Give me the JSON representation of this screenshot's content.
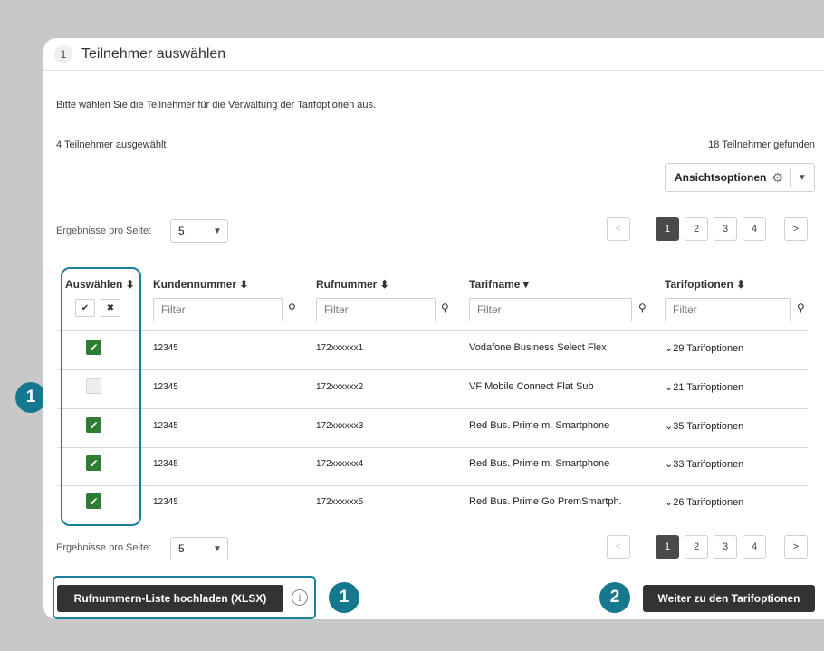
{
  "step": {
    "number": "1",
    "title": "Teilnehmer auswählen"
  },
  "intro_text": "Bitte wählen Sie die Teilnehmer für die Verwaltung der Tarifoptionen aus.",
  "selected_count": "4 Teilnehmer ausgewählt",
  "found_count": "18 Teilnehmer gefunden",
  "view_options_label": "Ansichtsoptionen",
  "per_page": {
    "label": "Ergebnisse pro Seite:",
    "value": "5"
  },
  "pagination": {
    "prev": "<",
    "next": ">",
    "pages": [
      "1",
      "2",
      "3",
      "4"
    ],
    "active": "1"
  },
  "columns": {
    "select": "Auswählen ⬍",
    "customer": "Kundennummer ⬍",
    "phone": "Rufnummer ⬍",
    "tariff": "Tarifname ▾",
    "options": "Tarifoptionen ⬍"
  },
  "filter_placeholder": "Filter",
  "select_all_symbol": "✔",
  "deselect_all_symbol": "✖",
  "rows": [
    {
      "checked": true,
      "customer": "12345",
      "phone": "172xxxxxx1",
      "tariff": "Vodafone Business Select Flex",
      "options": "29 Tarifoptionen"
    },
    {
      "checked": false,
      "customer": "12345",
      "phone": "172xxxxxx2",
      "tariff": "VF Mobile Connect Flat Sub",
      "options": "21 Tarifoptionen"
    },
    {
      "checked": true,
      "customer": "12345",
      "phone": "172xxxxxx3",
      "tariff": "Red Bus. Prime m. Smartphone",
      "options": "35 Tarifoptionen"
    },
    {
      "checked": true,
      "customer": "12345",
      "phone": "172xxxxxx4",
      "tariff": "Red Bus. Prime m. Smartphone",
      "options": "33 Tarifoptionen"
    },
    {
      "checked": true,
      "customer": "12345",
      "phone": "172xxxxxx5",
      "tariff": "Red Bus. Prime Go PremSmartph.",
      "options": "26 Tarifoptionen"
    }
  ],
  "upload_button": "Rufnummern-Liste hochladen (XLSX)",
  "info_symbol": "i",
  "next_button": "Weiter zu den Tarifoptionen",
  "badges": [
    "1",
    "1",
    "2"
  ],
  "colors": {
    "accent": "#15788f",
    "checkbox": "#2e7d32",
    "primary_button": "#333333"
  }
}
